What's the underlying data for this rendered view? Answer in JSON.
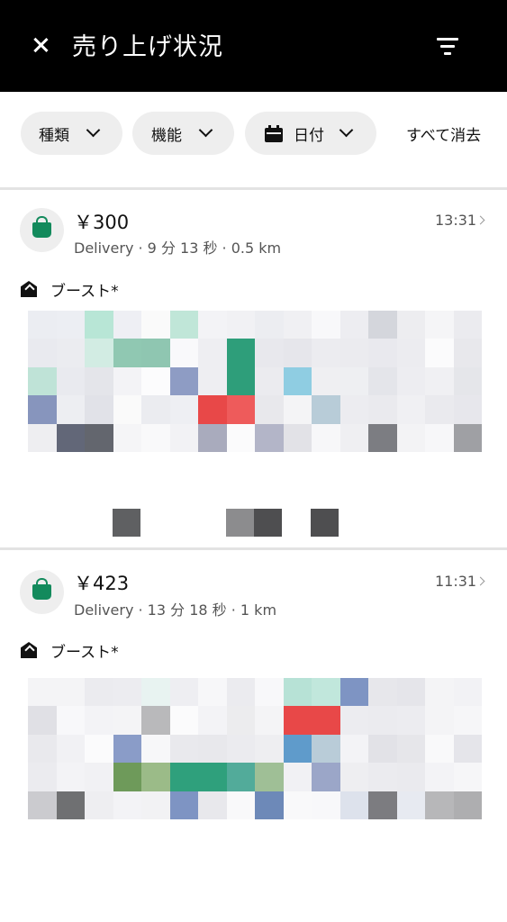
{
  "header": {
    "title": "売り上げ状況",
    "close_icon": "close-icon",
    "filter_icon": "filter-icon"
  },
  "filters": {
    "chips": [
      {
        "label": "種類"
      },
      {
        "label": "機能"
      },
      {
        "label": "日付",
        "icon": "calendar-icon"
      }
    ],
    "clear_all": "すべて消去"
  },
  "trips": [
    {
      "amount": "￥300",
      "time": "13:31",
      "meta": "Delivery · 9 分 13 秒 · 0.5 km",
      "boost": "ブースト*"
    },
    {
      "amount": "￥423",
      "time": "11:31",
      "meta": "Delivery · 13 分 18 秒 · 1 km",
      "boost": "ブースト*"
    }
  ],
  "colors": {
    "header_bg": "#000000",
    "brand_green": "#138a5c",
    "chip_bg": "#eeeeee"
  }
}
